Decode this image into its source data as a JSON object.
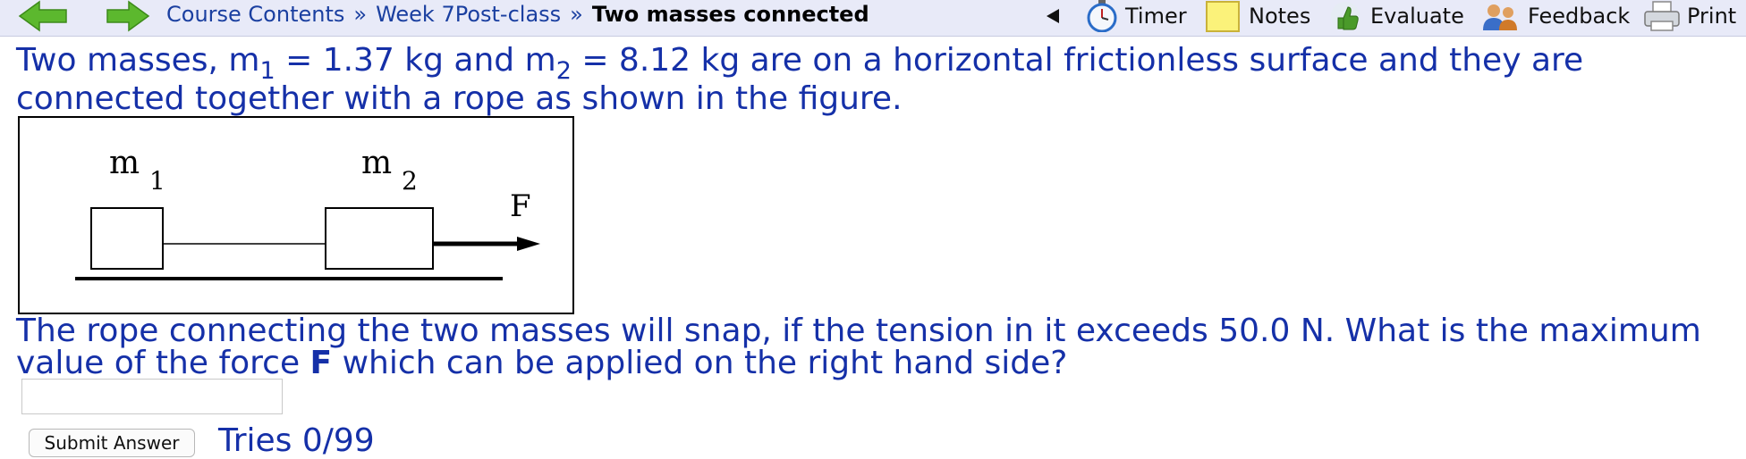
{
  "nav": {
    "back_icon": "green-left-arrow",
    "forward_icon": "green-right-arrow",
    "breadcrumb": {
      "item1": "Course Contents",
      "item2": "Week 7Post-class",
      "separator": "»",
      "current": "Two masses connected"
    },
    "tools": {
      "timer": "Timer",
      "notes": "Notes",
      "evaluate": "Evaluate",
      "feedback": "Feedback",
      "print": "Print"
    },
    "colors": {
      "bar": "#e8eaf8",
      "link": "#1a3fa0"
    }
  },
  "problem": {
    "intro_part1": "Two masses, m",
    "m1_sub": "1",
    "intro_part2": " = 1.37 kg and m",
    "m2_sub": "2",
    "intro_part3": " = 8.12 kg are on a horizontal frictionless surface and they are connected together with a rope as shown in the figure.",
    "question_part1": "The rope connecting the two masses will snap, if the tension in it exceeds 50.0 N. What is the maximum value of the force ",
    "question_bold": "F",
    "question_part2": " which can be applied on the right hand side?",
    "text_color": "#1530a8"
  },
  "figure": {
    "mass1_label": "m",
    "mass1_sub": "1",
    "mass2_label": "m",
    "mass2_sub": "2",
    "force_label": "F"
  },
  "answer": {
    "input_value": "",
    "submit_label": "Submit Answer",
    "tries_label": "Tries 0/99"
  }
}
